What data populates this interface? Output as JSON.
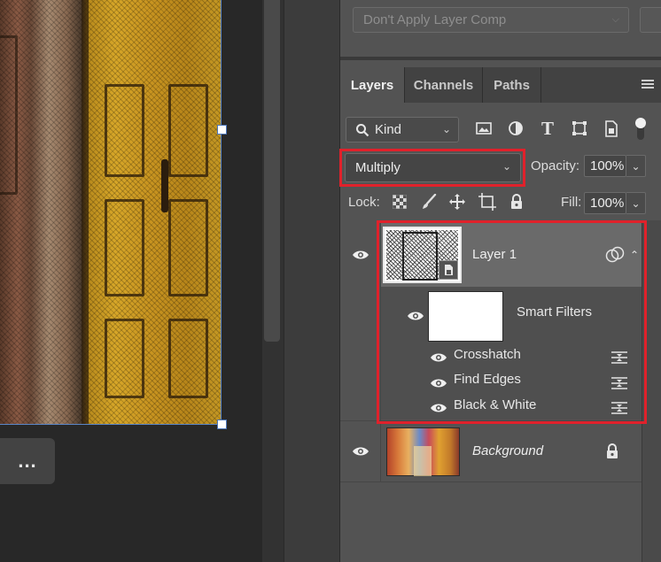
{
  "layer_comp": {
    "value": "Don't Apply Layer Comp"
  },
  "tabs": [
    {
      "label": "Layers",
      "active": true
    },
    {
      "label": "Channels",
      "active": false
    },
    {
      "label": "Paths",
      "active": false
    }
  ],
  "filter": {
    "kind_label": "Kind"
  },
  "blend_mode": {
    "value": "Multiply"
  },
  "opacity": {
    "label": "Opacity:",
    "value": "100%"
  },
  "lock": {
    "label": "Lock:"
  },
  "fill": {
    "label": "Fill:",
    "value": "100%"
  },
  "layers": [
    {
      "name": "Layer 1",
      "selected": true,
      "smart_object": true,
      "smart_filters": {
        "label": "Smart Filters",
        "items": [
          {
            "name": "Crosshatch"
          },
          {
            "name": "Find Edges"
          },
          {
            "name": "Black & White"
          }
        ]
      }
    },
    {
      "name": "Background",
      "locked": true
    }
  ],
  "canvas": {
    "more_button": "..."
  },
  "colors": {
    "panel_bg": "#535353",
    "selected_row": "#6a6a6a",
    "highlight_red": "#e0212b",
    "transform_handle_border": "#4a74b8"
  }
}
